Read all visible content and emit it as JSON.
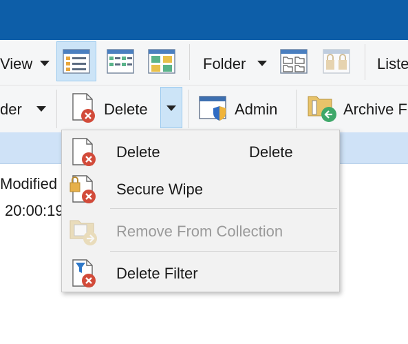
{
  "window": {
    "accent_color": "#0d5ea8"
  },
  "toolbar1": {
    "view_label": "View",
    "folder_label": "Folder",
    "lister_label": "Liste",
    "icons": [
      "details-view-icon",
      "list-view-icon",
      "thumbnails-view-icon",
      "folder-layout-icon",
      "lock-folder-icon"
    ]
  },
  "toolbar2": {
    "partial_label": "der",
    "delete_label": "Delete",
    "admin_label": "Admin",
    "archive_label": "Archive F"
  },
  "list": {
    "modified_header": "Modified",
    "modified_value": "20:00:19"
  },
  "menu": {
    "items": [
      {
        "label": "Delete",
        "shortcut": "Delete",
        "icon": "delete-file-icon",
        "enabled": true
      },
      {
        "label": "Secure Wipe",
        "shortcut": "",
        "icon": "secure-wipe-icon",
        "enabled": true
      },
      {
        "label": "Remove From Collection",
        "shortcut": "",
        "icon": "remove-from-collection-icon",
        "enabled": false
      },
      {
        "label": "Delete Filter",
        "shortcut": "",
        "icon": "delete-filter-icon",
        "enabled": true
      }
    ]
  }
}
